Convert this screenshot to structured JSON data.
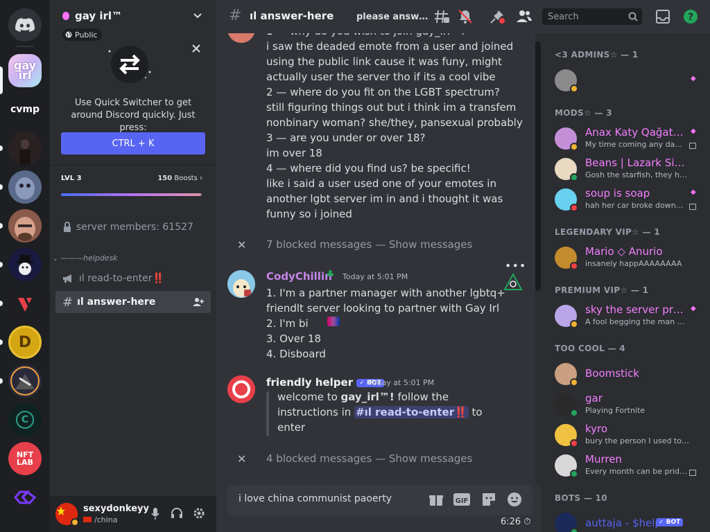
{
  "colors": {
    "blurple": "#5865f2",
    "online": "#23a55a",
    "idle": "#f0b232",
    "dnd": "#f23f43",
    "mod_pink": "#f47fff",
    "admin_gem": "#ff73fa",
    "mention": "#c9cdfb"
  },
  "rail": {
    "home_icon": "discord-logo-icon",
    "servers": [
      {
        "label": "gay irl",
        "color": "#f2d3f5"
      },
      {
        "label": "cvmp",
        "color": "#1e1f22"
      },
      {
        "label": "",
        "color": "#3a2f2f"
      },
      {
        "label": "",
        "color": "#3d4a6b"
      },
      {
        "label": "",
        "color": "#a46a5a"
      },
      {
        "label": "",
        "color": "#1a1a3a"
      },
      {
        "label": "",
        "color": "#2a1a1a"
      },
      {
        "label": "D",
        "color": "#d4a614"
      },
      {
        "label": "",
        "color": "#3a3a3a"
      },
      {
        "label": "C",
        "color": "#102220"
      },
      {
        "label": "NFT LAB",
        "color": "#e8404a"
      },
      {
        "label": "",
        "color": "#1e1f22"
      }
    ]
  },
  "sidebar": {
    "server_name": "gay irl™",
    "public_label": "Public",
    "switcher": {
      "text": "Use Quick Switcher to get around Discord quickly. Just press:",
      "shortcut": "CTRL + K"
    },
    "boost": {
      "level": "LVL 3",
      "count": "150",
      "count_suffix": "Boosts",
      "progress": 0.99
    },
    "members_channel": "server members: 61527",
    "category": "———helpdesk",
    "channels": [
      {
        "name": "ıl read-to-enter‼️",
        "active": false
      },
      {
        "name": "ıl answer-here",
        "active": true
      }
    ]
  },
  "user_panel": {
    "username": "sexydonkeyy",
    "status": "/china"
  },
  "header": {
    "channel": "ıl answer-here",
    "topic": "please answer ...",
    "search_placeholder": "Search"
  },
  "messages": {
    "block1_lines": [
      "1 — why do you wish to join gay_irl™?",
      "i saw the deaded emote from a user and joined",
      "using the public link cause it was funy, might",
      "actually user the server tho if its a cool vibe",
      "2 — where do you fit on the LGBT spectrum?",
      "still figuring things out but i think im a transfem",
      "nonbinary woman? she/they, pansexual probably",
      "3 — are you under or over 18?",
      "im over 18",
      "4 — where did you find us? be specific!",
      "like i said a user used one of your emotes in",
      "another lgbt server im in and i thought it was",
      "funny so i joined"
    ],
    "blocked1": "7 blocked messages — Show messages",
    "codychillin": {
      "author": "CodyChillin",
      "timestamp": "Today at 5:01 PM",
      "lines": [
        "1. I'm a partner manager with another lgbtq+",
        "friendlt server looking to partner with Gay Irl",
        "2. I'm bi",
        "3. Over 18",
        "4. Disboard"
      ]
    },
    "friendly_helper": {
      "author": "friendly helper",
      "bot_tag": "✓ BOT",
      "timestamp": "Today at 5:01 PM",
      "embed_1": "welcome to ",
      "embed_bold": "gay_irl™!",
      "embed_2": " follow the",
      "embed_3": "instructions in ",
      "embed_mention": "#ıl read-to-enter‼️",
      "embed_4": " to",
      "embed_5": "enter"
    },
    "blocked2": "4 blocked messages — Show messages"
  },
  "composer": {
    "text": "i love china communist paoerty",
    "slowmode": "6:26"
  },
  "members": {
    "groups": [
      {
        "header": "<3 ADMINS☆ — 1",
        "items": [
          {
            "name": "",
            "status": "",
            "color": "#f2f3f5",
            "dot": "idle",
            "av": "#8a8a8a",
            "gem": true,
            "note": false
          }
        ]
      },
      {
        "header": "MODS☆ — 3",
        "items": [
          {
            "name": "Anax Katy Qağatad...",
            "status": "My time coming any da...",
            "color": "#f47fff",
            "dot": "idle",
            "av": "#c58fd8",
            "gem": true,
            "note": true
          },
          {
            "name": "Beans | Lazark Simp",
            "status": "Gosh the starfish, they hav...",
            "color": "#f47fff",
            "dot": "online",
            "av": "#e8d9c0",
            "gem": false,
            "note": false
          },
          {
            "name": "soup is soap",
            "status": "hah her car broke down...",
            "color": "#f47fff",
            "dot": "dnd",
            "av": "#6ad0f0",
            "gem": true,
            "note": true
          }
        ]
      },
      {
        "header": "LEGENDARY VIP☆ — 1",
        "items": [
          {
            "name": "Mario ◇ Anurio",
            "status": "insanely happAAAAAAAA",
            "color": "#f47fff",
            "dot": "dnd",
            "av": "#c28b2c",
            "gem": false,
            "note": false
          }
        ]
      },
      {
        "header": "PREMIUM VIP☆ — 1",
        "items": [
          {
            "name": "sky the server proto...",
            "status": "A fool begging the man who co...",
            "color": "#f47fff",
            "dot": "idle",
            "av": "#b9a6e8",
            "gem": true,
            "note": false
          }
        ]
      },
      {
        "header": "TOO COOL — 4",
        "items": [
          {
            "name": "Boomstick",
            "status": "",
            "color": "#f47fff",
            "dot": "idle",
            "av": "#caa080",
            "gem": false,
            "note": false
          },
          {
            "name": "gar",
            "status": "Playing Fortnite",
            "color": "#f47fff",
            "dot": "online",
            "av": "#2a2a2a",
            "gem": false,
            "note": false
          },
          {
            "name": "kyro",
            "status": "bury the person I used to be m...",
            "color": "#f47fff",
            "dot": "dnd",
            "av": "#f0c040",
            "gem": false,
            "note": false
          },
          {
            "name": "Murren",
            "status": "Every month can be pridem...",
            "color": "#f47fff",
            "dot": "online",
            "av": "#d8d8d8",
            "gem": false,
            "note": true
          }
        ]
      },
      {
        "header": "BOTS — 10",
        "items": [
          {
            "name": "auttaja - $help",
            "status": "",
            "color": "#5865f2",
            "dot": "online",
            "av": "#1a2a5a",
            "gem": false,
            "note": false,
            "bot": "✓ BOT"
          }
        ]
      }
    ]
  }
}
